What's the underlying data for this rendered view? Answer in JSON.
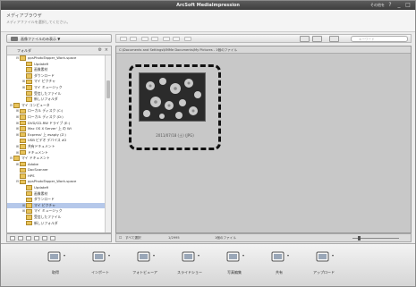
{
  "window": {
    "title": "ArcSoft MediaImpression",
    "menu_label": "その他を",
    "minimize": "_",
    "maximize": "□"
  },
  "header": {
    "title": "メディアブラウザ",
    "subtitle": "メディアファイルを選択してください。"
  },
  "top_dropdown": {
    "label": "画像ファイルのみ表示 ▼"
  },
  "sidebar": {
    "header_label": "フォルダ",
    "items": [
      {
        "label": "ppsPhotoTapper_Work-space",
        "level": 1,
        "expander": "⊟"
      },
      {
        "label": "Updatefi",
        "level": 2,
        "expander": ""
      },
      {
        "label": "画像素材",
        "level": 2,
        "expander": ""
      },
      {
        "label": "ダウンロード",
        "level": 2,
        "expander": ""
      },
      {
        "label": "マイ ピクチャ",
        "level": 2,
        "expander": "⊞"
      },
      {
        "label": "マイ ミュージック",
        "level": 2,
        "expander": "⊞"
      },
      {
        "label": "受信したファイル",
        "level": 2,
        "expander": ""
      },
      {
        "label": "新しいフォルダ",
        "level": 2,
        "expander": ""
      },
      {
        "label": "マイ コンピュータ",
        "level": 0,
        "expander": "⊟"
      },
      {
        "label": "ローカル ディスク (C:)",
        "level": 1,
        "expander": "⊞"
      },
      {
        "label": "ローカル ディスク (D:)",
        "level": 1,
        "expander": "⊞"
      },
      {
        "label": "DVD/CD-RW ドライブ (E:)",
        "level": 1,
        "expander": "⊞"
      },
      {
        "label": "Mac OS X Server' 上 の Wi",
        "level": 1,
        "expander": "⊞"
      },
      {
        "label": "Express' 上 esapty (Z:)",
        "level": 1,
        "expander": "⊞"
      },
      {
        "label": "USB ビデオ デバイス #2",
        "level": 1,
        "expander": ""
      },
      {
        "label": "共有ドキュメント",
        "level": 1,
        "expander": "⊞"
      },
      {
        "label": "ドキュメント",
        "level": 1,
        "expander": "⊞"
      },
      {
        "label": "マイ ドキュメント",
        "level": 0,
        "expander": "⊟"
      },
      {
        "label": "Adobe",
        "level": 1,
        "expander": "⊞"
      },
      {
        "label": "DocScanner",
        "level": 1,
        "expander": ""
      },
      {
        "label": "HPS",
        "level": 1,
        "expander": ""
      },
      {
        "label": "ppsPhotoTapper_Work-space",
        "level": 1,
        "expander": "⊟"
      },
      {
        "label": "Updatefi",
        "level": 2,
        "expander": ""
      },
      {
        "label": "画像素材",
        "level": 2,
        "expander": ""
      },
      {
        "label": "ダウンロード",
        "level": 2,
        "expander": ""
      },
      {
        "label": "マイ ピクチャ",
        "level": 2,
        "expander": "⊞",
        "selected": true
      },
      {
        "label": "マイ ミュージック",
        "level": 2,
        "expander": "⊞"
      },
      {
        "label": "受信したファイル",
        "level": 2,
        "expander": ""
      },
      {
        "label": "新しいフォルダ",
        "level": 2,
        "expander": ""
      }
    ]
  },
  "toolbar": {
    "search_placeholder": "キーワード"
  },
  "content": {
    "path": "C:\\Documents and Settings\\KMMe Documents\\My Pictures - 1個のファイル",
    "thumbnail": {
      "caption": "2011/07/18 (土) (JPG)"
    }
  },
  "status": {
    "select_all": "すべて選択",
    "count": "1/2995",
    "files": "1個のファイル"
  },
  "bottom_tools": [
    {
      "label": "取得",
      "icon": "monitor-icon"
    },
    {
      "label": "インポート",
      "icon": "import-icon"
    },
    {
      "label": "フォトビューア",
      "icon": "photo-viewer-icon"
    },
    {
      "label": "スライドショー",
      "icon": "slideshow-icon"
    },
    {
      "label": "写真編集",
      "icon": "edit-photo-icon"
    },
    {
      "label": "共有",
      "icon": "share-icon"
    },
    {
      "label": "アップロード",
      "icon": "upload-icon"
    }
  ],
  "colors": {
    "titlebar": "#4a4a4a",
    "selection": "#b5c8ea",
    "content_bg": "#c8c8c8",
    "folder": "#e8c35a"
  }
}
